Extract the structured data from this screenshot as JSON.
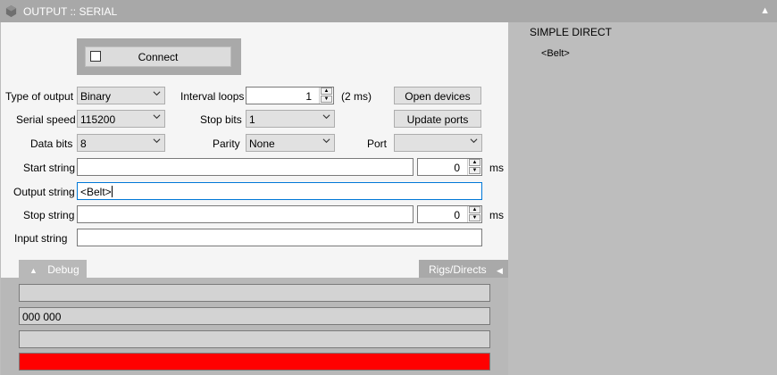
{
  "window": {
    "title": "OUTPUT :: SERIAL"
  },
  "connect": {
    "label": "Connect",
    "checked": false
  },
  "labels": {
    "type_of_output": "Type of output",
    "serial_speed": "Serial speed",
    "data_bits": "Data bits",
    "interval_loops": "Interval loops",
    "stop_bits": "Stop bits",
    "parity": "Parity",
    "port": "Port",
    "start_string": "Start string",
    "output_string": "Output string",
    "stop_string": "Stop string",
    "input_string": "Input string",
    "ms": "ms"
  },
  "fields": {
    "type_of_output": "Binary",
    "serial_speed": "115200",
    "data_bits": "8",
    "interval_loops": "1",
    "interval_ms": "(2 ms)",
    "stop_bits": "1",
    "parity": "None",
    "port": "",
    "start_string": "",
    "start_delay": "0",
    "output_string": "<Belt>",
    "stop_string": "",
    "stop_delay": "0",
    "input_string": ""
  },
  "buttons": {
    "open_devices": "Open devices",
    "update_ports": "Update ports"
  },
  "tabs": {
    "debug": "Debug",
    "rigs_directs": "Rigs/Directs"
  },
  "debug": {
    "line1": "",
    "line2": "000 000",
    "line3": "",
    "status_color": "#ff0000"
  },
  "side": {
    "heading": "SIMPLE DIRECT",
    "items": [
      "<Belt>"
    ]
  },
  "icons": {
    "title": "app-hexagon-icon",
    "collapse": "triangle-up-icon",
    "dropdown": "chevron-down-icon",
    "spin_up": "spin-up-icon",
    "spin_down": "spin-down-icon",
    "debug_tab": "triangle-up-icon",
    "rigs_tab": "triangle-left-icon"
  }
}
